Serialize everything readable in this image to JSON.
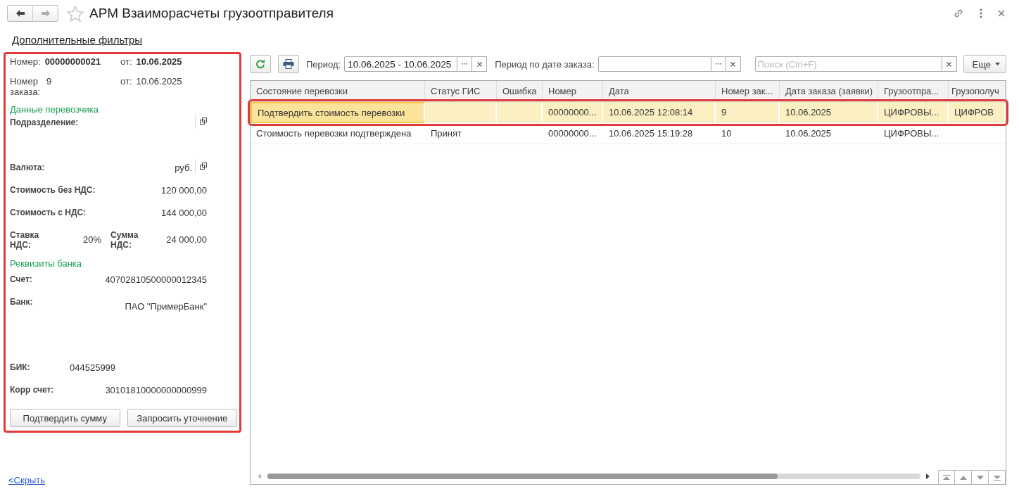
{
  "window": {
    "title": "АРМ Взаиморасчеты грузоотправителя"
  },
  "filters_link": "Дополнительные фильтры",
  "details": {
    "number_label": "Номер:",
    "number": "00000000021",
    "number_date_label": "от:",
    "number_date": "10.06.2025",
    "order_label": "Номер заказа:",
    "order": "9",
    "order_date_label": "от:",
    "order_date": "10.06.2025",
    "carrier_section": "Данные перевозчика",
    "carrier_fields": [
      {
        "kind": "select",
        "label": "Подразделение:"
      },
      {
        "kind": "select",
        "label": "Валюта:",
        "value": "руб."
      },
      {
        "kind": "number",
        "label": "Стоимость без НДС:",
        "value": "120 000,00"
      },
      {
        "kind": "number",
        "label": "Стоимость с НДС:",
        "value": "144 000,00"
      }
    ],
    "vat": {
      "rate_label": "Ставка НДС:",
      "rate": "20%",
      "sum_label": "Сумма НДС:",
      "sum": "24 000,00"
    },
    "bank_section": "Реквизиты банка",
    "bank_fields": [
      {
        "kind": "number",
        "label": "Счет:",
        "value": "40702810500000012345"
      },
      {
        "kind": "memo",
        "label": "Банк:",
        "value": "ПАО \"ПримерБанк\""
      },
      {
        "kind": "short",
        "label": "БИК:",
        "value": "044525999"
      },
      {
        "kind": "number",
        "label": "Корр счет:",
        "value": "30101810000000000999"
      }
    ],
    "buttons": [
      "Подтвердить сумму",
      "Запросить уточнение"
    ]
  },
  "hide_link": "<Скрыть",
  "toolbar": {
    "period_label": "Период:",
    "period": "10.06.2025 - 10.06.2025",
    "order_period_label": "Период по дате заказа:",
    "search_placeholder": "Поиск (Ctrl+F)",
    "more": "Еще"
  },
  "table": {
    "columns": [
      "Состояние перевозки",
      "Статус ГИС",
      "Ошибка",
      "Номер",
      "Дата",
      "Номер зак...",
      "Дата заказа (заявки)",
      "Грузоотпра...",
      "Грузополуч"
    ],
    "rows": [
      {
        "selected": true,
        "cells": [
          "Подтвердить стоимость перевозки",
          "",
          "",
          "00000000...",
          "10.06.2025 12:08:14",
          "9",
          "10.06.2025",
          "ЦИФРОВЫ...",
          "ЦИФРОВ"
        ]
      },
      {
        "selected": false,
        "cells": [
          "Стоимость перевозки подтверждена",
          "Принят",
          "",
          "00000000...",
          "10.06.2025 15:19:28",
          "10",
          "10.06.2025",
          "ЦИФРОВЫ...",
          ""
        ]
      }
    ]
  }
}
